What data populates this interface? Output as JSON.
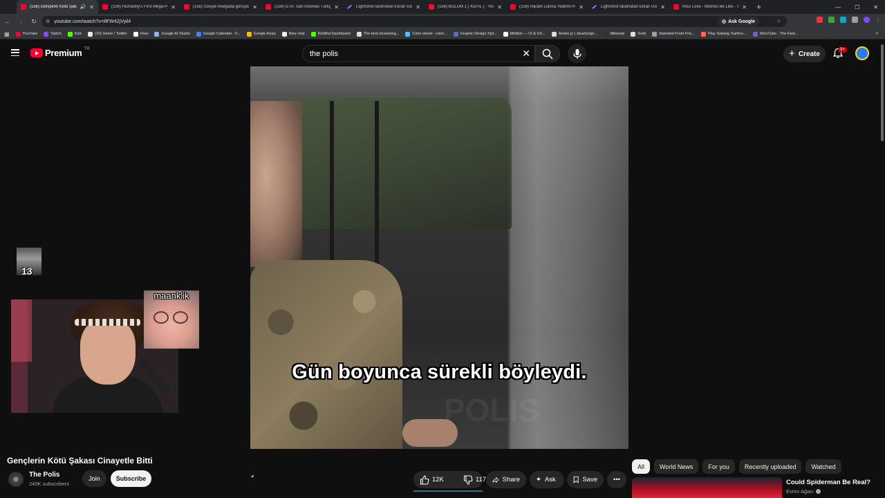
{
  "browser": {
    "tabs": [
      {
        "title": "(156) Gençlerin Kötü Şakası",
        "fav": "yt",
        "active": true
      },
      {
        "title": "(156) Humanity's First Mega-P...",
        "fav": "yt"
      },
      {
        "title": "(156) Sosyal medyada görüştü...",
        "fav": "yt"
      },
      {
        "title": "(156) GTA: San Andreas Türkçe...",
        "fav": "yt"
      },
      {
        "title": "LightShot tarafından Ekran Gör...",
        "fav": "ls"
      },
      {
        "title": "(156) BÖLÜM 1 ( KEFİL ) - YouT...",
        "fav": "yt"
      },
      {
        "title": "(156) Haram Lokma Yedirmi H...",
        "fav": "yt"
      },
      {
        "title": "LightShot tarafından Ekran Gör...",
        "fav": "ls"
      },
      {
        "title": "Rico Love - Bitches Be Like - Yo...",
        "fav": "yt"
      }
    ],
    "url": "youtube.com/watch?v=8FW42jVyil4",
    "ask_google": "Ask Google",
    "bookmarks": [
      {
        "label": "YouTube",
        "color": "#ff0033"
      },
      {
        "label": "Twitch",
        "color": "#9146ff"
      },
      {
        "label": "Kick",
        "color": "#53fc18"
      },
      {
        "label": "(10) Home / Twitter",
        "color": "#e7e9ea"
      },
      {
        "label": "Flow",
        "color": "#ffffff"
      },
      {
        "label": "Google AI Studio",
        "color": "#8ab4f8"
      },
      {
        "label": "Google Calendar - F...",
        "color": "#4285f4"
      },
      {
        "label": "Google Keep",
        "color": "#fbbc04"
      },
      {
        "label": "New chat",
        "color": "#eeeeee"
      },
      {
        "label": "KickBot Dashboard",
        "color": "#53fc18"
      },
      {
        "label": "The best streaming...",
        "color": "#dddddd"
      },
      {
        "label": "Color wheel - color...",
        "color": "#4fc3f7"
      },
      {
        "label": "Graphic Design Styl...",
        "color": "#5c6bc0"
      },
      {
        "label": "Mobbin — UI & UX...",
        "color": "#ffffff"
      },
      {
        "label": "Anime.js | JavaScript...",
        "color": "#dddddd"
      },
      {
        "label": "Milanote",
        "color": "#333333"
      },
      {
        "label": "Grok",
        "color": "#dddddd"
      },
      {
        "label": "Imported From Fire...",
        "color": "#9aa0a6"
      },
      {
        "label": "Play Subway Surfers...",
        "color": "#ff7043"
      },
      {
        "label": "SliceTube - The Fast...",
        "color": "#7e57c2"
      }
    ]
  },
  "header": {
    "logo": "Premium",
    "country": "TR",
    "search_query": "the polis",
    "create_label": "Create",
    "notif_badge": "9+"
  },
  "video": {
    "subtitle": "Gün boyunca sürekli böyleydi.",
    "watermark": "POLIS",
    "title": "Gençlerin Kötü Şakası Cinayetle Bitti"
  },
  "overlay": {
    "cat_number": "13",
    "facecam_name": "maanklik"
  },
  "channel": {
    "name": "The Polis",
    "subscribers": "240K subscribers",
    "join_label": "Join",
    "subscribe_label": "Subscribe"
  },
  "actions": {
    "likes": "12K",
    "dislikes": "117",
    "share": "Share",
    "ask": "Ask",
    "save": "Save"
  },
  "chips": [
    "All",
    "World News",
    "For you",
    "Recently uploaded",
    "Watched"
  ],
  "recommendation": {
    "title": "Could Spiderman Be Real?",
    "channel": "Evrim Ağacı"
  }
}
